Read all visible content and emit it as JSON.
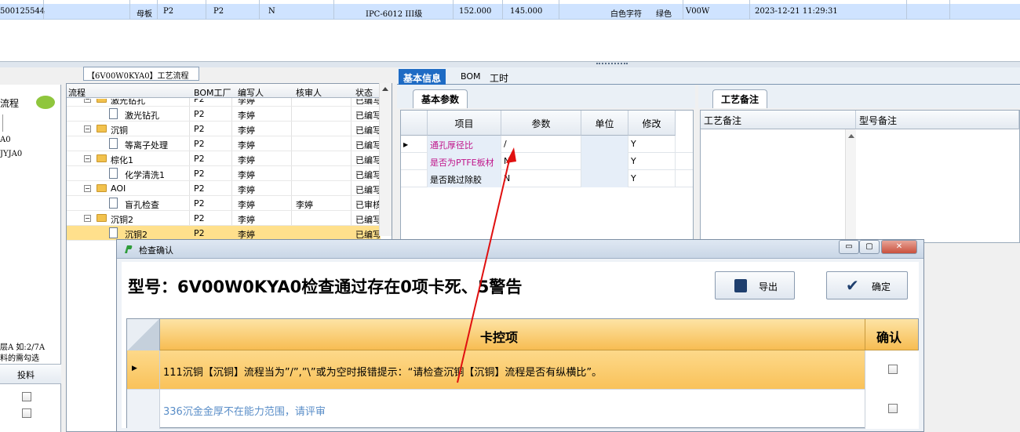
{
  "top_row": {
    "cells": [
      "500125544",
      "母板",
      "P2",
      "P2",
      "N",
      "IPC-6012 III级",
      "152.000",
      "145.000",
      "白色字符",
      "绿色",
      "V00W",
      "2023-12-21 11:29:31"
    ]
  },
  "left_panel": {
    "label_process": "流程",
    "line_a": "A0",
    "line_b": "JYJA0",
    "hint1": "层A 如:2/7A",
    "hint2": "料的需勾选",
    "col_feed": "投料"
  },
  "tree": {
    "title": "【6V00W0KYA0】工艺流程",
    "headers": [
      "流程",
      "BOM工厂",
      "编写人",
      "核审人",
      "状态"
    ],
    "rows": [
      {
        "name": "激光钻孔",
        "kind": "folder",
        "bom": "P2",
        "writer": "李婷",
        "reviewer": "",
        "status": "已编写"
      },
      {
        "name": "激光钻孔",
        "kind": "doc",
        "bom": "P2",
        "writer": "李婷",
        "reviewer": "",
        "status": "已编写"
      },
      {
        "name": "沉铜",
        "kind": "folder",
        "bom": "P2",
        "writer": "李婷",
        "reviewer": "",
        "status": "已编写"
      },
      {
        "name": "等离子处理",
        "kind": "doc",
        "bom": "P2",
        "writer": "李婷",
        "reviewer": "",
        "status": "已编写"
      },
      {
        "name": "棕化1",
        "kind": "folder",
        "bom": "P2",
        "writer": "李婷",
        "reviewer": "",
        "status": "已编写"
      },
      {
        "name": "化学清洗1",
        "kind": "doc",
        "bom": "P2",
        "writer": "李婷",
        "reviewer": "",
        "status": "已编写"
      },
      {
        "name": "AOI",
        "kind": "folder",
        "bom": "P2",
        "writer": "李婷",
        "reviewer": "",
        "status": "已编写"
      },
      {
        "name": "盲孔检查",
        "kind": "doc",
        "bom": "P2",
        "writer": "李婷",
        "reviewer": "李婷",
        "status": "已审核"
      },
      {
        "name": "沉铜2",
        "kind": "folder",
        "bom": "P2",
        "writer": "李婷",
        "reviewer": "",
        "status": "已编写"
      },
      {
        "name": "沉铜2",
        "kind": "doc",
        "bom": "P2",
        "writer": "李婷",
        "reviewer": "",
        "status": "已编写"
      }
    ]
  },
  "tabs": [
    "基本信息",
    "BOM",
    "工时"
  ],
  "param_panel": {
    "subtab": "基本参数",
    "headers": [
      "项目",
      "参数",
      "单位",
      "修改"
    ],
    "rows": [
      {
        "item": "通孔厚径比",
        "param": "/",
        "unit": "",
        "modify": "Y"
      },
      {
        "item": "是否为PTFE板材",
        "param": "N",
        "unit": "",
        "modify": "Y"
      },
      {
        "item": "是否跳过除胶",
        "param": "N",
        "unit": "",
        "modify": "Y"
      }
    ]
  },
  "remark_panel": {
    "subtab": "工艺备注",
    "headers": [
      "工艺备注",
      "型号备注"
    ]
  },
  "dialog": {
    "title": "检查确认",
    "heading": "型号：6V00W0KYA0检查通过存在0项卡死、5警告",
    "export_label": "导出",
    "confirm_label": "确定",
    "col_item": "卡控项",
    "col_confirm": "确认",
    "rows": [
      {
        "text": "111沉铜【沉铜】流程当为”/”,”\\”或为空时报错提示：“请检查沉铜【沉铜】流程是否有纵横比”。",
        "checked": false
      },
      {
        "text": "336沉金金厚不在能力范围，请评审",
        "checked": false
      }
    ]
  },
  "colors": {
    "accent": "#1e6bc4",
    "selected_row": "#ffe08c",
    "warn_header": "#f7bd52",
    "link_text": "#c0158a",
    "arrow": "#e01010"
  }
}
